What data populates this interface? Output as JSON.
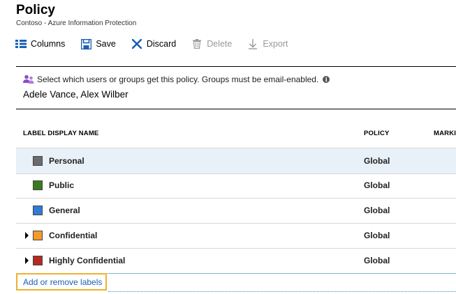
{
  "header": {
    "title": "Policy",
    "subtitle": "Contoso - Azure Information Protection"
  },
  "toolbar": {
    "columns_label": "Columns",
    "save_label": "Save",
    "discard_label": "Discard",
    "delete_label": "Delete",
    "export_label": "Export"
  },
  "scope": {
    "prompt": "Select which users or groups get this policy. Groups must be email-enabled.",
    "assigned": "Adele Vance, Alex Wilber"
  },
  "table": {
    "columns": [
      "LABEL DISPLAY NAME",
      "POLICY",
      "MARKI"
    ],
    "rows": [
      {
        "name": "Personal",
        "policy": "Global",
        "color": "#6b6b6b",
        "expandable": false,
        "selected": true
      },
      {
        "name": "Public",
        "policy": "Global",
        "color": "#3a7a1e",
        "expandable": false,
        "selected": false
      },
      {
        "name": "General",
        "policy": "Global",
        "color": "#2f7bd6",
        "expandable": false,
        "selected": false
      },
      {
        "name": "Confidential",
        "policy": "Global",
        "color": "#f39a2a",
        "expandable": true,
        "selected": false
      },
      {
        "name": "Highly Confidential",
        "policy": "Global",
        "color": "#b52a1e",
        "expandable": true,
        "selected": false
      }
    ]
  },
  "footer": {
    "add_remove_label": "Add or remove labels"
  },
  "colors": {
    "accent_link": "#1a5fb4",
    "highlight_border": "#f0b030",
    "selected_row_bg": "#e8f0f8"
  }
}
